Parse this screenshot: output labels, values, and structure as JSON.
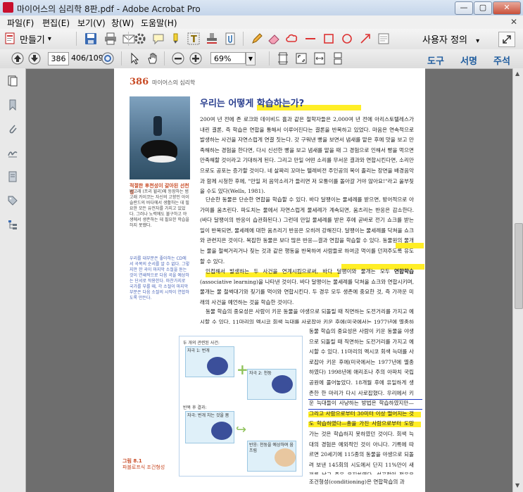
{
  "window": {
    "title": "마이어스의 심리학 8판.pdf - Adobe Acrobat Pro",
    "minimize": "—",
    "maximize": "▢",
    "close": "✕"
  },
  "menu": {
    "items": [
      "파일(F)",
      "편집(E)",
      "보기(V)",
      "창(W)",
      "도움말(H)"
    ],
    "close_glyph": "✕"
  },
  "toolbar": {
    "create_label": "만들기",
    "create_arrow": "▾",
    "user_defined": "사용자 정의",
    "user_defined_arrow": "▾"
  },
  "nav": {
    "page_input": "386",
    "page_count": "406/1093",
    "zoom": "69%",
    "tabs": [
      "도구",
      "서명",
      "주석"
    ]
  },
  "document": {
    "page_number": "386",
    "running_head": "마이어스의 심리학",
    "photo_caption_title": "적절한 후천성이 갈아된 선천성",
    "photo_caption_body": "범고래 (프리 윌리)에 등장하는 범고래 카이코는 자신의 고향인 아이슬란드의 바다에서 생활하는 데 필요한 모든 유전자를 가지고 있었다. 그러나 노력에도 불구하고 야생에서 생존하는 데 필요한 학습을 하지 못했다.",
    "side_note": "우리를 대부분은 좋아하는 CD에서 곡목의 순서를 알 수 없다. 그렇지만 한 곡이 마지막 소절을 듣는 것이 연쇄적으로 다음 곡을 예상하는 단서로 작용한다. 마찬가지로 국가를 부를 때, 각 소절이 마지막 부분은 다음 소절의 시작이 연합하도록 만든다.",
    "article_title": "우리는 어떻게 학습하는가?",
    "paragraph1": "200여 년 전에 존 로크와 데이비드 흄과 같은 철학자들은 2,000여 년 전에 아리스토텔레스가 내린 결론, 즉 학습은 연합을 통해서 이루어진다는 결론을 반복하고 있었다. 마음은 연속적으로 발생하는 사건을 자연스럽게 연결 짓는다. 갓 구워낸 빵을 보면서 냄새를 맡은 후에 맛을 보고 만족해하는 경험을 한다면, 다시 신선한 빵을 보고 냄새를 맡을 때 그 경험으로 인해서 빵을 먹으면 만족해할 것이라고 기대하게 된다. 그리고 만일 어떤 소리를 무서운 결과와 연합시킨다면, 소리만으로도 공포는 증가할 것이다. 네 살짜리 꼬마는 텔레비전 주인공의 목이 졸리는 장면을 배경음악과 함께 시청한 후에, \"만일 저 음악소리가 들리면 저 모퉁이를 돌아갈 거야 않아요!\"라고 울부짖을 수도 있다(Wells, 1981).",
    "paragraph2": "단순한 동물은 단순한 연합을 학습할 수 있다. 바다 달팽이는 물세례를 받으면, 방어적으로 아가미를 움츠린다. 파도치는 물에서 자연스럽게 물세례가 계속되면, 움츠리는 반응은 감소한다. (바다 달팽이의 반응이 습관화된다.) 그런데 만일 물세례를 받은 후에 곧바로 전기 쇼크를 받는 일이 반복되면, 물세례에 대한 움츠리기 반응은 오히려 강해진다. 달팽이는 물세례를 닥쳐올 쇼크와 관련지은 것이다. 복잡한 동물은 보다 많은 반응—결과 연합을 학습할 수 있다. 동물원의 물개는 물을 철썩거리거나 짖는 것과 같은 행동을 반복하여 사람들로 하여금 먹이를 던져주도록 유도할 수 있다.",
    "paragraph3": "인접해서 발생하는 두 사건을 연계시킴으로써, 바다 달팽이와 물개는 모두 연합학습(associative learning)을 나타낸 것이다. 바다 달팽이는 물세례를 닥쳐올 쇼크와 연합시키며, 물개는 물 철썩대기와 짖기를 먹이와 연합시킨다. 두 경우 모두 생존에 중요한 것, 즉 가까운 미래의 사건을 예언하는 것을 학습한 것이다.",
    "paragraph3_bold": "연합학습",
    "paragraph4": "동물 학습의 중요성은 사람이 키운 동물을 야생으로 되돌릴 때 직면하는 도전거리를 가지고 예시할 수 있다. 11마리의 멕시코 회색 늑대를 사로잡아 키운 후에(미국에서는 1977년에 멸종하였다) 1998년에 애리조나 주의 아파치 국립공원에 풀어놓았다. 18개월 후에 유일하게 생존한 한 마리가 다시 사로잡혔다. 우리에서 키운 늑대들이 사냥하는 방법은 학습하였지만—그리고 사람으로부터 30미터 이상 떨어지는 것도 학습하였다—총을 가진 사람으로부터 도망가는 것은 학습하지 못하였던 것이다. 회색 늑대의 경험은 예외적인 것이 아니다. 기록에 따르면 20세기에 115종의 동물을 야생으로 되돌려 보낸 145회의 시도에서 단지 11%만이 새끼를 낳고 종을 유지하였다. 성공적인 적응은 선천성(필요한 유전적 성향)과 후천성(적절한 학습)을 모두 필요로 한다.",
    "paragraph5": "조건형성(conditioning)은 연합학습의 과",
    "figure": {
      "heading": "두 개의 관련된 사건:",
      "event1": "자극 1: 번개",
      "event2": "자극 2: 천둥",
      "after_heading": "반복 후 결과:",
      "result_stimulus": "자극: 번개 치는 것을 봄",
      "result_response": "반응: 천둥을 예상하며 움츠림",
      "label": "그림 8.1",
      "label_sub": "파블로프식 조건형성"
    }
  }
}
